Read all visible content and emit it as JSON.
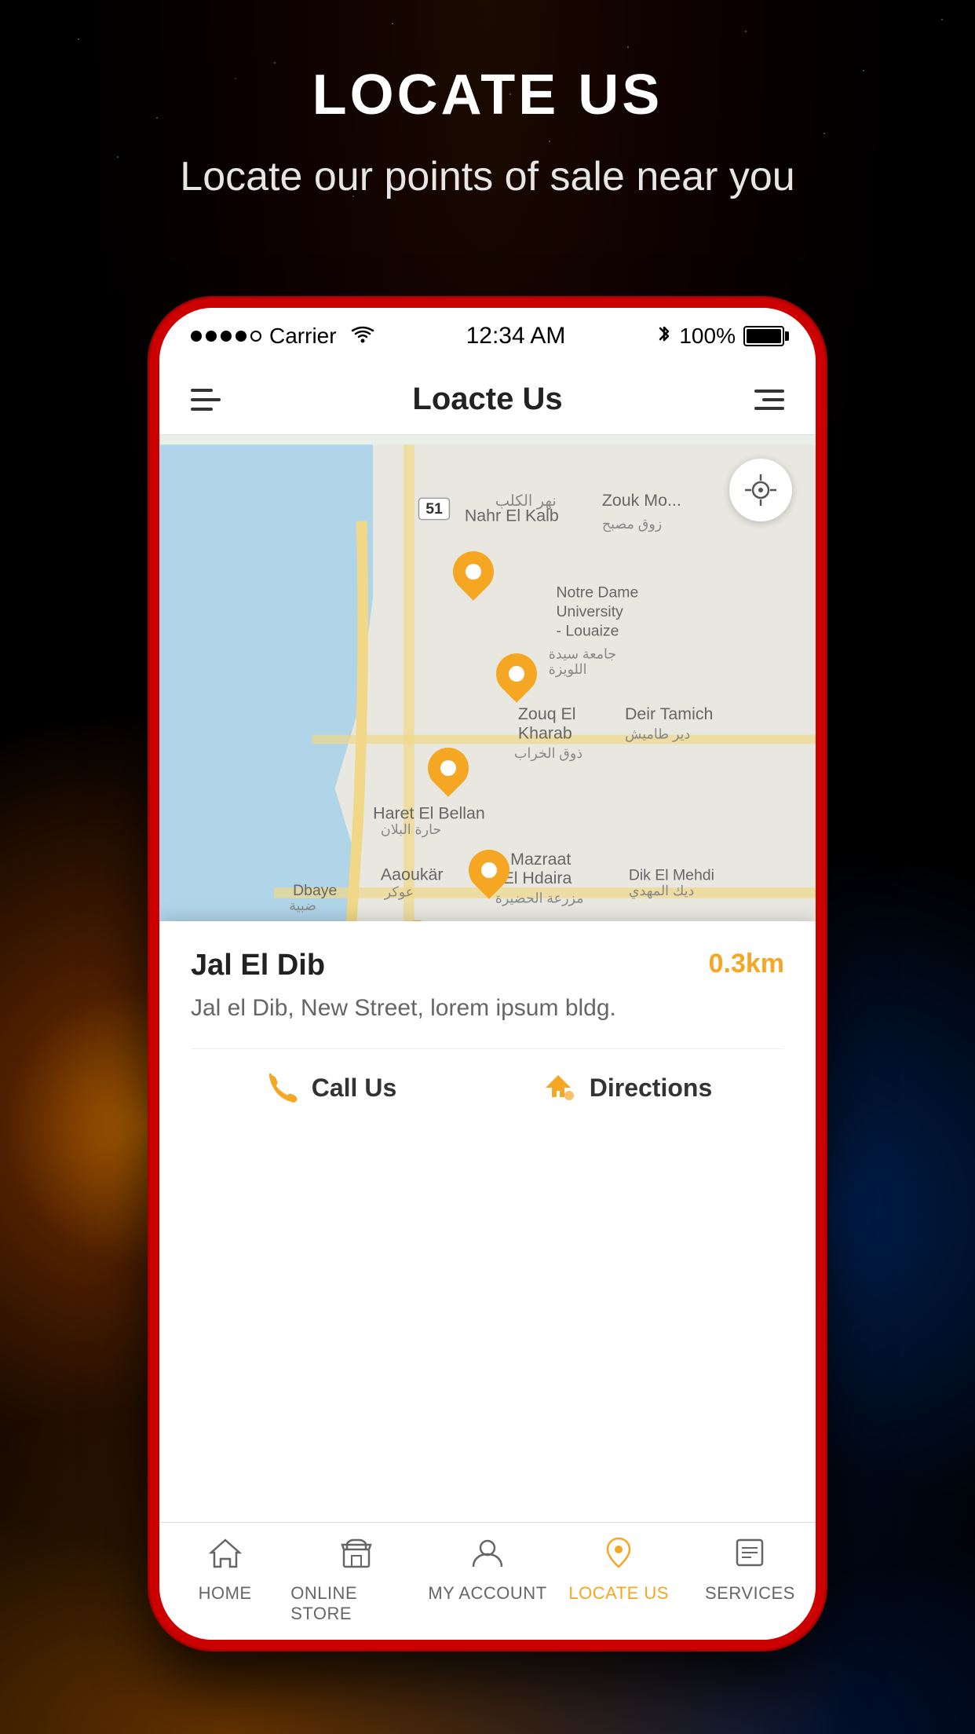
{
  "background": {
    "color": "#000000"
  },
  "header": {
    "title": "LOCATE US",
    "subtitle": "Locate our points of sale near you"
  },
  "status_bar": {
    "carrier": "Carrier",
    "time": "12:34 AM",
    "battery_percent": "100%"
  },
  "app_header": {
    "title": "Loacte Us"
  },
  "map": {
    "location_button_label": "⊕"
  },
  "info_card": {
    "name": "Jal El Dib",
    "distance": "0.3km",
    "address": "Jal el Dib, New Street, lorem ipsum bldg.",
    "actions": {
      "call": "Call Us",
      "directions": "Directions"
    }
  },
  "bottom_nav": {
    "items": [
      {
        "id": "home",
        "label": "HOME",
        "active": false
      },
      {
        "id": "online-store",
        "label": "ONLINE STORE",
        "active": false
      },
      {
        "id": "my-account",
        "label": "MY ACCOUNT",
        "active": false
      },
      {
        "id": "locate-us",
        "label": "LOCATE US",
        "active": true
      },
      {
        "id": "services",
        "label": "SERVICES",
        "active": false
      }
    ]
  }
}
